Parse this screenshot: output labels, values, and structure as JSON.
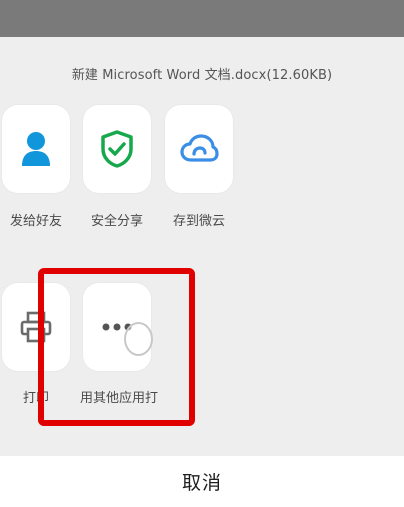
{
  "share_sheet": {
    "file_title": "新建 Microsoft Word 文档.docx(12.60KB)",
    "row1": [
      {
        "label": "发给好友",
        "icon": "person-icon",
        "color": "#1296db"
      },
      {
        "label": "安全分享",
        "icon": "shield-check-icon",
        "color": "#15a84d"
      },
      {
        "label": "存到微云",
        "icon": "cloud-icon",
        "color": "#3a8ee6"
      }
    ],
    "row2": [
      {
        "label": "打印",
        "icon": "printer-icon",
        "color": "#6b6b6b"
      },
      {
        "label": "用其他应用打",
        "icon": "more-dots-icon",
        "color": "#555555"
      }
    ],
    "cancel_label": "取消"
  },
  "colors": {
    "highlight": "#e00000",
    "backdrop": "#7a7a7a",
    "sheet_bg": "#eeeeee"
  }
}
